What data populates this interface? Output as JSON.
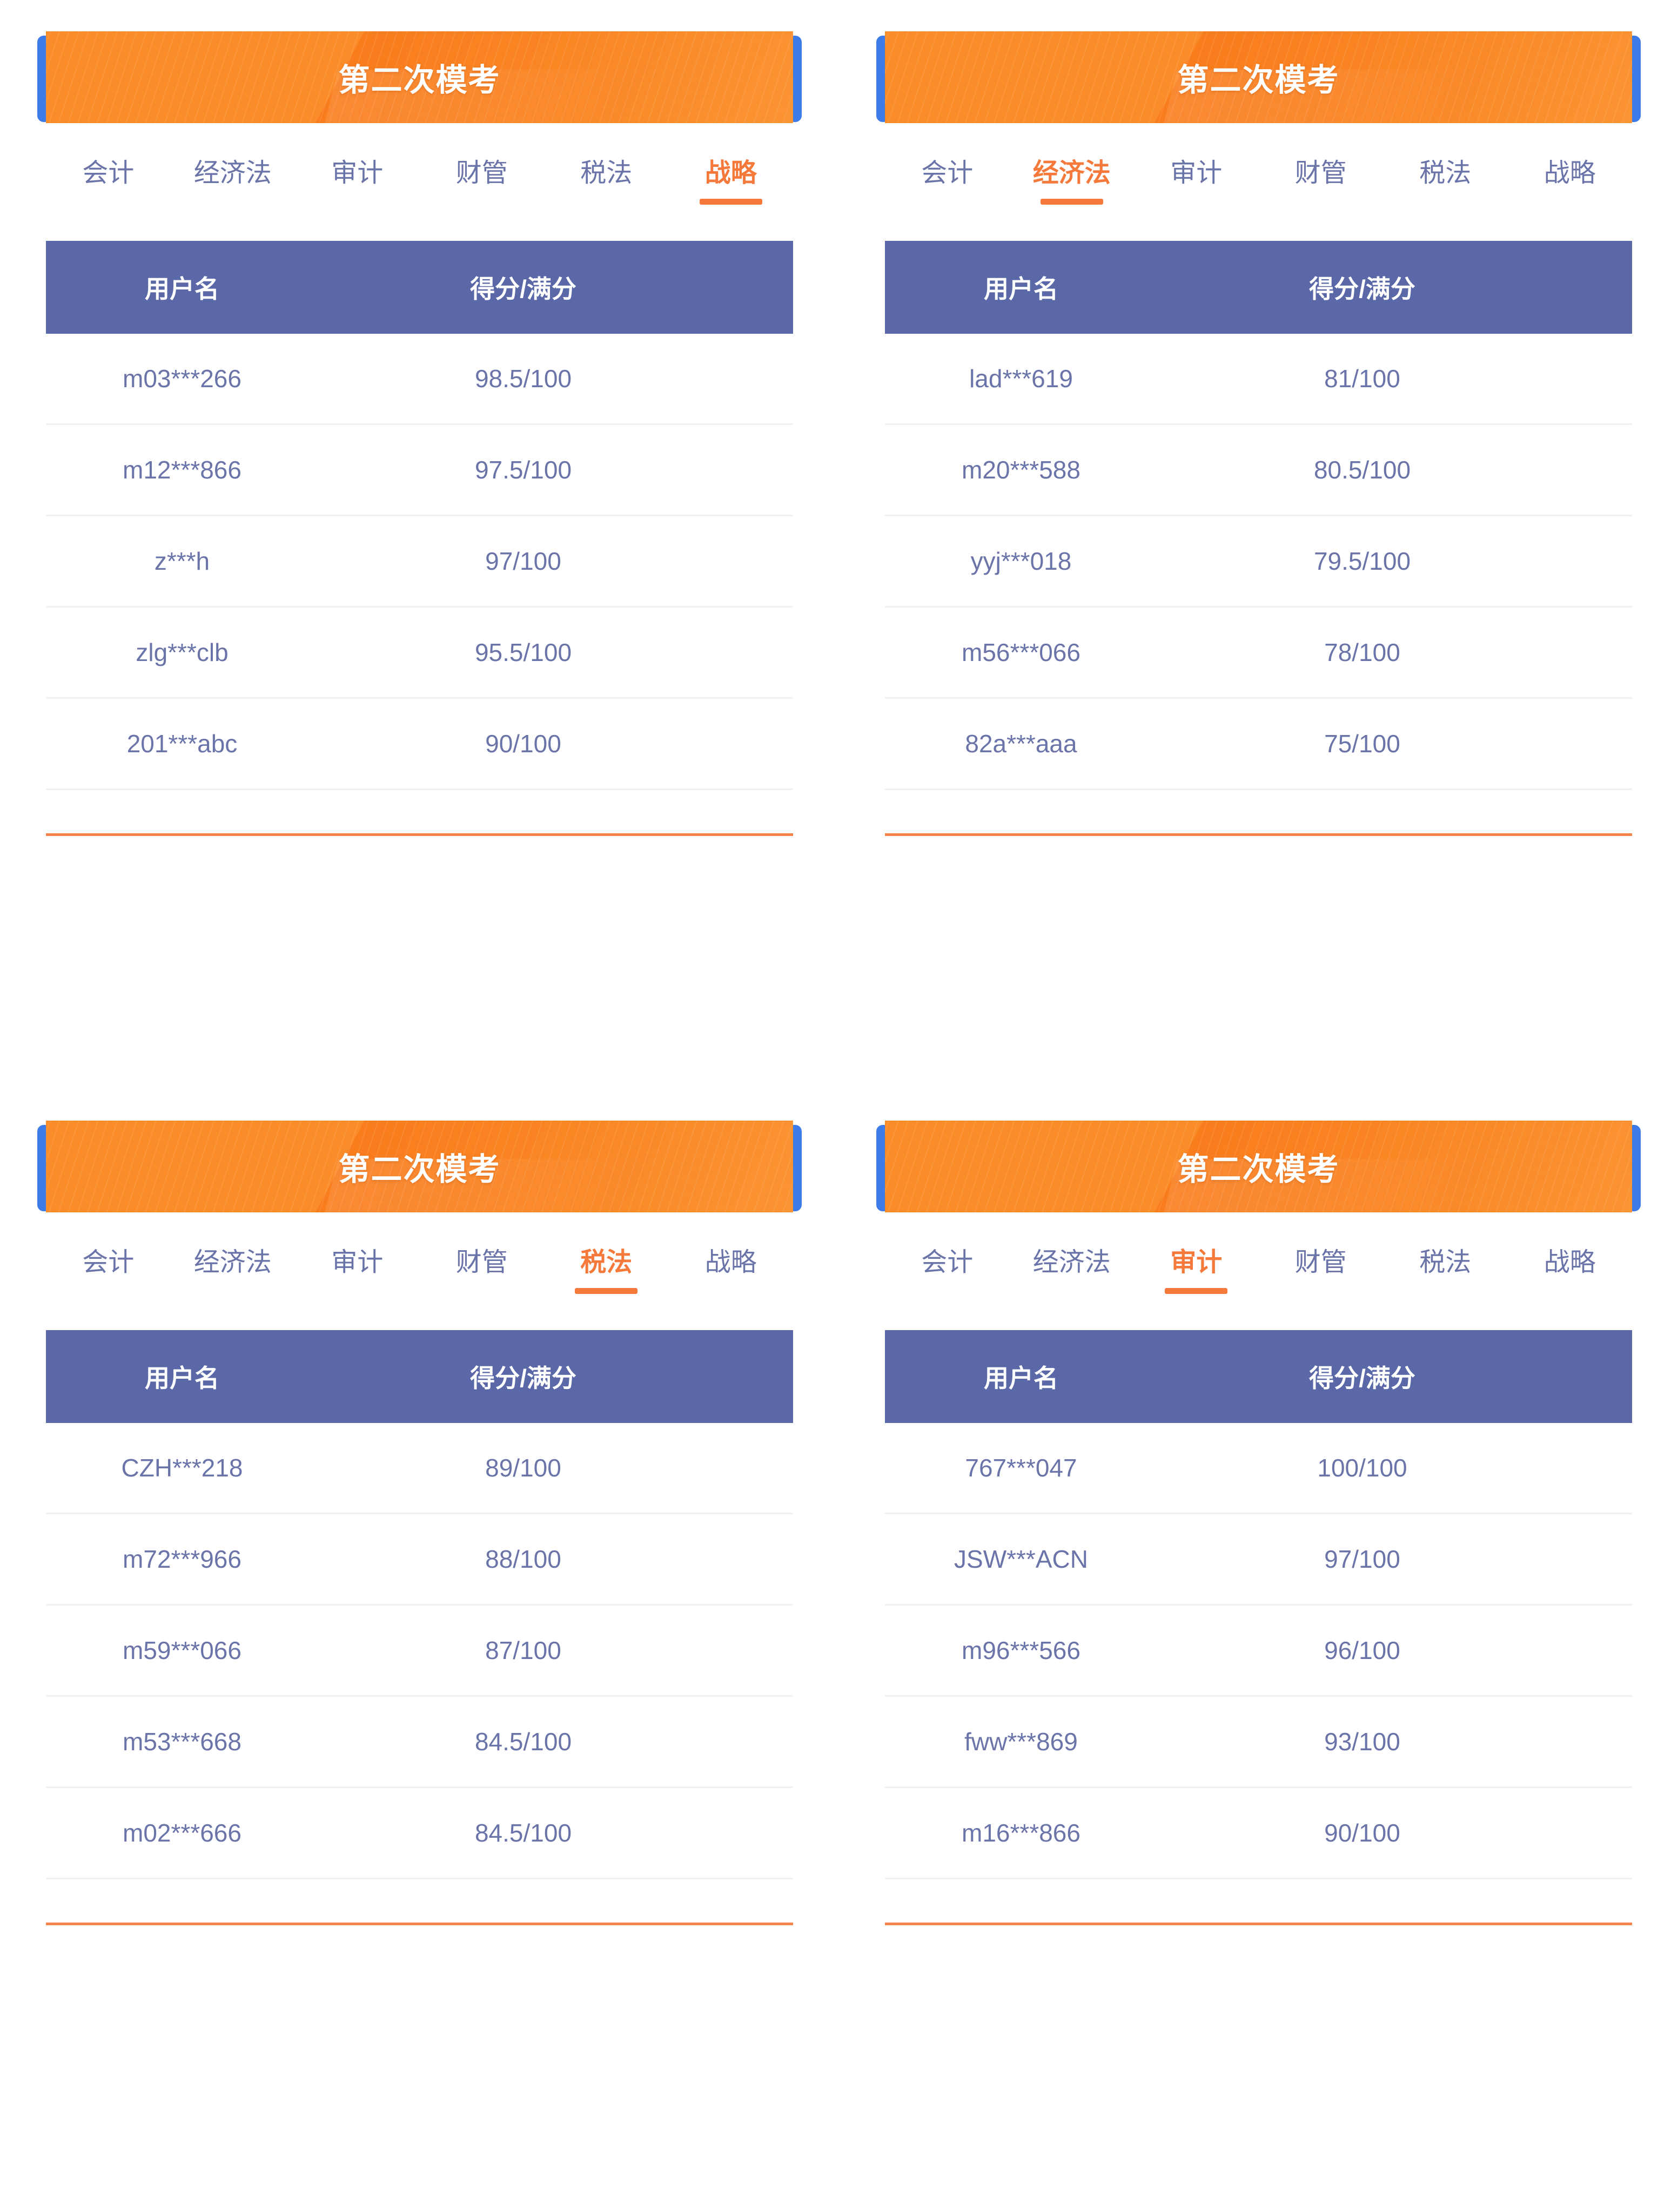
{
  "colors": {
    "banner_orange": "#fb8c2a",
    "banner_edge_blue": "#3d7ce8",
    "table_header_blue": "#5a68a8",
    "text_blue": "#6a74a8",
    "accent_orange": "#f5793b",
    "row_divider": "#f1f1f3"
  },
  "table_headers": {
    "username": "用户名",
    "score": "得分/满分"
  },
  "panels": [
    {
      "banner_title": "第二次模考",
      "tabs": [
        {
          "label": "会计",
          "active": false
        },
        {
          "label": "经济法",
          "active": false
        },
        {
          "label": "审计",
          "active": false
        },
        {
          "label": "财管",
          "active": false
        },
        {
          "label": "税法",
          "active": false
        },
        {
          "label": "战略",
          "active": true
        }
      ],
      "active_tab": "战略",
      "rows": [
        {
          "username": "m03***266",
          "score": "98.5/100"
        },
        {
          "username": "m12***866",
          "score": "97.5/100"
        },
        {
          "username": "z***h",
          "score": "97/100"
        },
        {
          "username": "zlg***clb",
          "score": "95.5/100"
        },
        {
          "username": "201***abc",
          "score": "90/100"
        }
      ]
    },
    {
      "banner_title": "第二次模考",
      "tabs": [
        {
          "label": "会计",
          "active": false
        },
        {
          "label": "经济法",
          "active": true
        },
        {
          "label": "审计",
          "active": false
        },
        {
          "label": "财管",
          "active": false
        },
        {
          "label": "税法",
          "active": false
        },
        {
          "label": "战略",
          "active": false
        }
      ],
      "active_tab": "经济法",
      "rows": [
        {
          "username": "lad***619",
          "score": "81/100"
        },
        {
          "username": "m20***588",
          "score": "80.5/100"
        },
        {
          "username": "yyj***018",
          "score": "79.5/100"
        },
        {
          "username": "m56***066",
          "score": "78/100"
        },
        {
          "username": "82a***aaa",
          "score": "75/100"
        }
      ]
    },
    {
      "banner_title": "第二次模考",
      "tabs": [
        {
          "label": "会计",
          "active": false
        },
        {
          "label": "经济法",
          "active": false
        },
        {
          "label": "审计",
          "active": false
        },
        {
          "label": "财管",
          "active": false
        },
        {
          "label": "税法",
          "active": true
        },
        {
          "label": "战略",
          "active": false
        }
      ],
      "active_tab": "税法",
      "rows": [
        {
          "username": "CZH***218",
          "score": "89/100"
        },
        {
          "username": "m72***966",
          "score": "88/100"
        },
        {
          "username": "m59***066",
          "score": "87/100"
        },
        {
          "username": "m53***668",
          "score": "84.5/100"
        },
        {
          "username": "m02***666",
          "score": "84.5/100"
        }
      ]
    },
    {
      "banner_title": "第二次模考",
      "tabs": [
        {
          "label": "会计",
          "active": false
        },
        {
          "label": "经济法",
          "active": false
        },
        {
          "label": "审计",
          "active": true
        },
        {
          "label": "财管",
          "active": false
        },
        {
          "label": "税法",
          "active": false
        },
        {
          "label": "战略",
          "active": false
        }
      ],
      "active_tab": "审计",
      "rows": [
        {
          "username": "767***047",
          "score": "100/100"
        },
        {
          "username": "JSW***ACN",
          "score": "97/100"
        },
        {
          "username": "m96***566",
          "score": "96/100"
        },
        {
          "username": "fww***869",
          "score": "93/100"
        },
        {
          "username": "m16***866",
          "score": "90/100"
        }
      ]
    }
  ]
}
